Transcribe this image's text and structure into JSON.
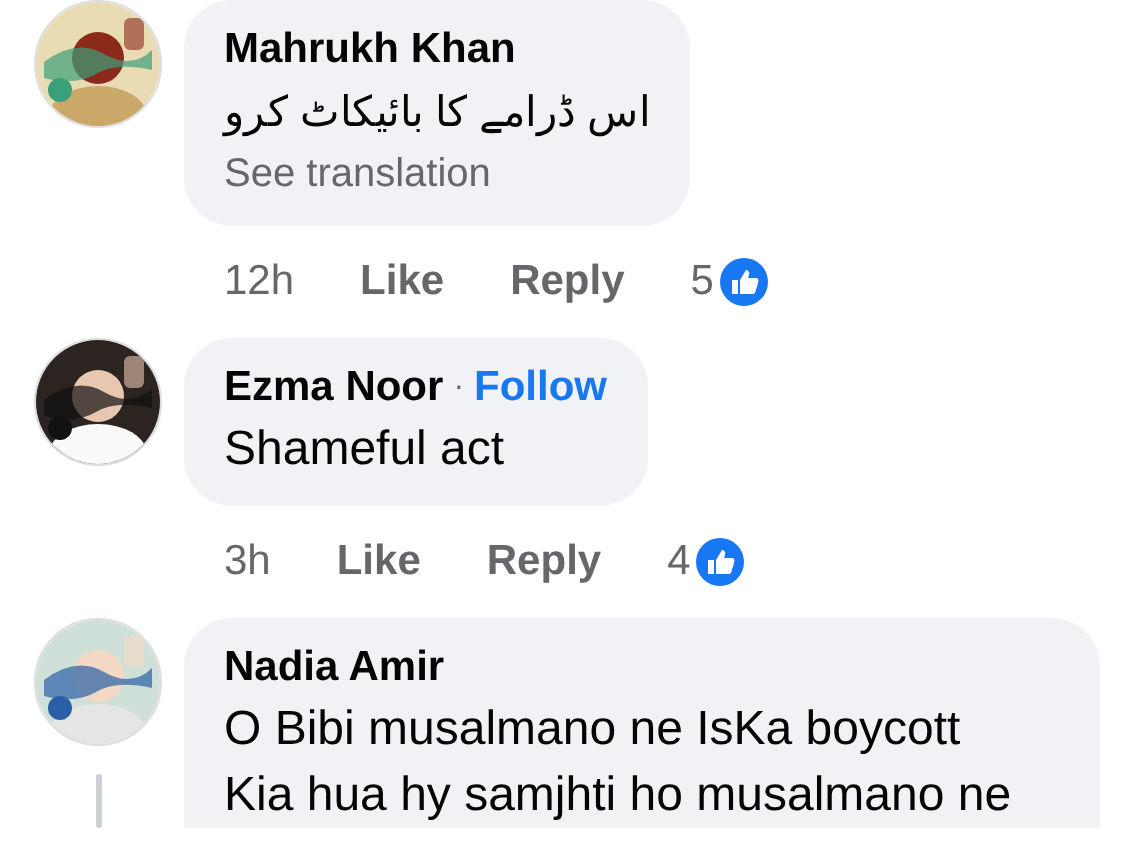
{
  "comments": [
    {
      "author": "Mahrukh Khan",
      "text": "اس ڈرامے کا بائیکاٹ کرو",
      "translation": "See translation",
      "time": "12h",
      "like": "Like",
      "reply": "Reply",
      "reactions": "5",
      "thread_line": false
    },
    {
      "author": "Ezma Noor",
      "separator": "·",
      "follow": "Follow",
      "text": "Shameful act",
      "time": "3h",
      "like": "Like",
      "reply": "Reply",
      "reactions": "4",
      "thread_line": false
    },
    {
      "author": "Nadia Amir",
      "text": "O Bibi musalmano ne IsKa boycott Kia hua hy samjhti ho musalmano ne",
      "thread_line": true
    }
  ]
}
